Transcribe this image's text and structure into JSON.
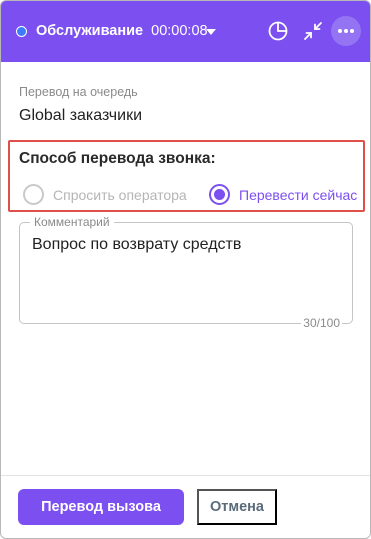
{
  "header": {
    "status_label": "Обслуживание",
    "timer": "00:00:08",
    "icons": [
      "pie-chart-icon",
      "collapse-arrows-icon",
      "more-horizontal-icon"
    ],
    "accent_color": "#7b4ff0",
    "status_dot_color": "#3d7bff"
  },
  "queue": {
    "label": "Перевод на очередь",
    "value": "Global заказчики"
  },
  "transfer_method": {
    "title": "Способ перевода звонка:",
    "options": [
      {
        "label": "Спросить оператора",
        "selected": false
      },
      {
        "label": "Перевести сейчас",
        "selected": true
      }
    ]
  },
  "comment": {
    "legend": "Комментарий",
    "value": "Вопрос по возврату средств",
    "counter": "30/100"
  },
  "footer": {
    "primary_label": "Перевод вызова",
    "cancel_label": "Отмена"
  }
}
